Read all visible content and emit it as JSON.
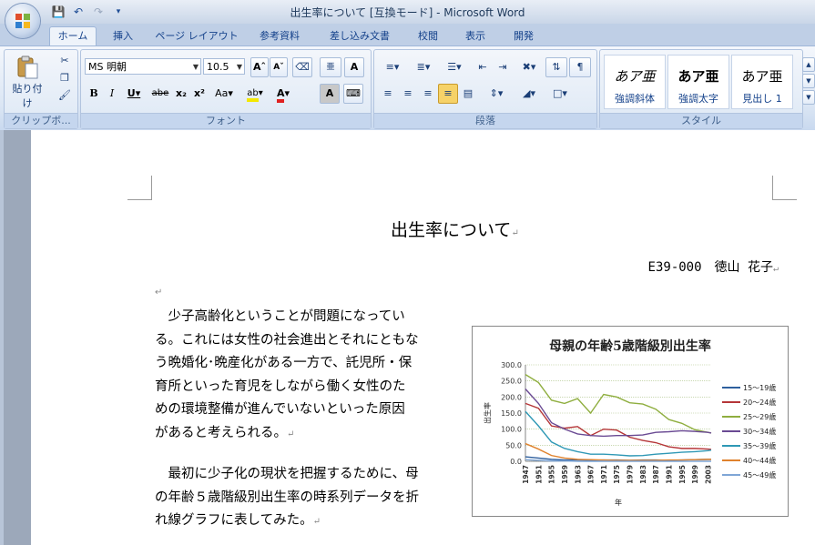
{
  "window": {
    "title": "出生率について [互換モード] - Microsoft Word"
  },
  "quick_access": {
    "icons": [
      "save-icon",
      "undo-icon",
      "redo-icon",
      "customize-icon"
    ]
  },
  "tabs": [
    {
      "label": "ホーム",
      "active": true
    },
    {
      "label": "挿入"
    },
    {
      "label": "ページ レイアウト"
    },
    {
      "label": "参考資料"
    },
    {
      "label": "差し込み文書"
    },
    {
      "label": "校閲"
    },
    {
      "label": "表示"
    },
    {
      "label": "開発"
    }
  ],
  "ribbon": {
    "clipboard": {
      "label": "クリップボ...",
      "paste": "貼り付け"
    },
    "font": {
      "label": "フォント",
      "font_name": "MS 明朝",
      "font_size": "10.5",
      "aa_button": "Aa"
    },
    "paragraph": {
      "label": "段落"
    },
    "styles": {
      "label": "スタイル",
      "items": [
        {
          "preview": "あア亜",
          "name": "強調斜体"
        },
        {
          "preview": "あア亜",
          "name": "強調太字"
        },
        {
          "preview": "あア亜",
          "name": "見出し 1"
        }
      ]
    }
  },
  "document": {
    "title": "出生率について",
    "author": "E39-000　徳山 花子",
    "paragraph1_lines": [
      "　少子高齢化ということが問題になってい",
      "る。これには女性の社会進出とそれにともな",
      "う晩婚化･晩産化がある一方で、託児所・保",
      "育所といった育児をしながら働く女性のた",
      "めの環境整備が進んでいないといった原因",
      "があると考えられる。"
    ],
    "paragraph2_lines": [
      "　最初に少子化の現状を把握するために、母",
      "の年齢５歳階級別出生率の時系列データを折",
      "れ線グラフに表してみた。"
    ],
    "return_mark": "↵"
  },
  "chart_data": {
    "type": "line",
    "title": "母親の年齢5歳階級別出生率",
    "xlabel": "年",
    "ylabel": "出生率",
    "ylim": [
      0,
      300
    ],
    "yticks": [
      "0.0",
      "50.0",
      "100.0",
      "150.0",
      "200.0",
      "250.0",
      "300.0"
    ],
    "xtick_labels": [
      "1947",
      "1951",
      "1955",
      "1959",
      "1963",
      "1967",
      "1971",
      "1975",
      "1979",
      "1983",
      "1987",
      "1991",
      "1995",
      "1999",
      "2003"
    ],
    "x": [
      1947,
      1951,
      1955,
      1959,
      1963,
      1967,
      1971,
      1975,
      1979,
      1983,
      1987,
      1991,
      1995,
      1999,
      2003,
      2004
    ],
    "grid": true,
    "legend_position": "right",
    "series": [
      {
        "name": "15～19歳",
        "color": "#2e5f9e",
        "values": [
          14,
          10,
          6,
          4,
          4,
          3,
          4,
          4,
          3,
          4,
          4,
          3,
          4,
          5,
          6,
          6
        ]
      },
      {
        "name": "20～24歳",
        "color": "#b53638",
        "values": [
          180,
          165,
          110,
          103,
          108,
          80,
          100,
          97,
          75,
          65,
          58,
          45,
          40,
          40,
          38,
          37
        ]
      },
      {
        "name": "25～29歳",
        "color": "#8fae3f",
        "values": [
          270,
          245,
          190,
          180,
          195,
          150,
          208,
          200,
          182,
          178,
          162,
          130,
          118,
          98,
          90,
          88
        ]
      },
      {
        "name": "30～34歳",
        "color": "#6a4a93",
        "values": [
          225,
          180,
          120,
          100,
          85,
          80,
          78,
          80,
          80,
          82,
          90,
          92,
          95,
          93,
          90,
          88
        ]
      },
      {
        "name": "35～39歳",
        "color": "#2f98b5",
        "values": [
          155,
          110,
          60,
          40,
          30,
          22,
          22,
          20,
          17,
          18,
          22,
          25,
          28,
          30,
          33,
          35
        ]
      },
      {
        "name": "40～44歳",
        "color": "#e0822d",
        "values": [
          55,
          38,
          18,
          10,
          6,
          5,
          4,
          3,
          3,
          3,
          3,
          4,
          4,
          5,
          6,
          6
        ]
      },
      {
        "name": "45～49歳",
        "color": "#7fa6d6",
        "values": [
          5,
          3,
          1,
          1,
          0,
          0,
          0,
          0,
          0,
          0,
          0,
          0,
          0,
          0,
          0,
          0
        ]
      }
    ]
  }
}
